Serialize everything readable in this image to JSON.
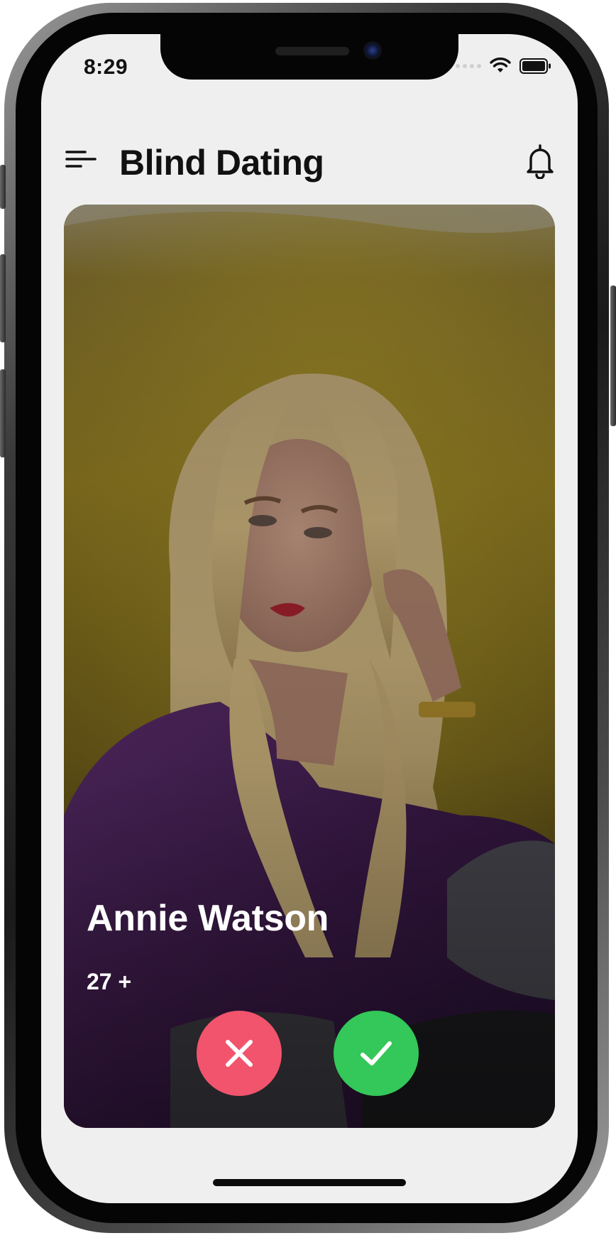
{
  "status_bar": {
    "time": "8:29",
    "icons": [
      "signal-dots-icon",
      "wifi-icon",
      "battery-icon"
    ]
  },
  "header": {
    "title": "Blind Dating",
    "menu_icon": "hamburger-menu-icon",
    "notification_icon": "bell-icon"
  },
  "profile_card": {
    "name": "Annie Watson",
    "age": "27 +",
    "actions": [
      {
        "icon": "close-icon",
        "color": "#f2546d"
      },
      {
        "icon": "checkmark-icon",
        "color": "#34c759"
      }
    ]
  },
  "colors": {
    "background": "#efefef",
    "reject": "#f2546d",
    "accept": "#34c759",
    "title": "#111111"
  }
}
